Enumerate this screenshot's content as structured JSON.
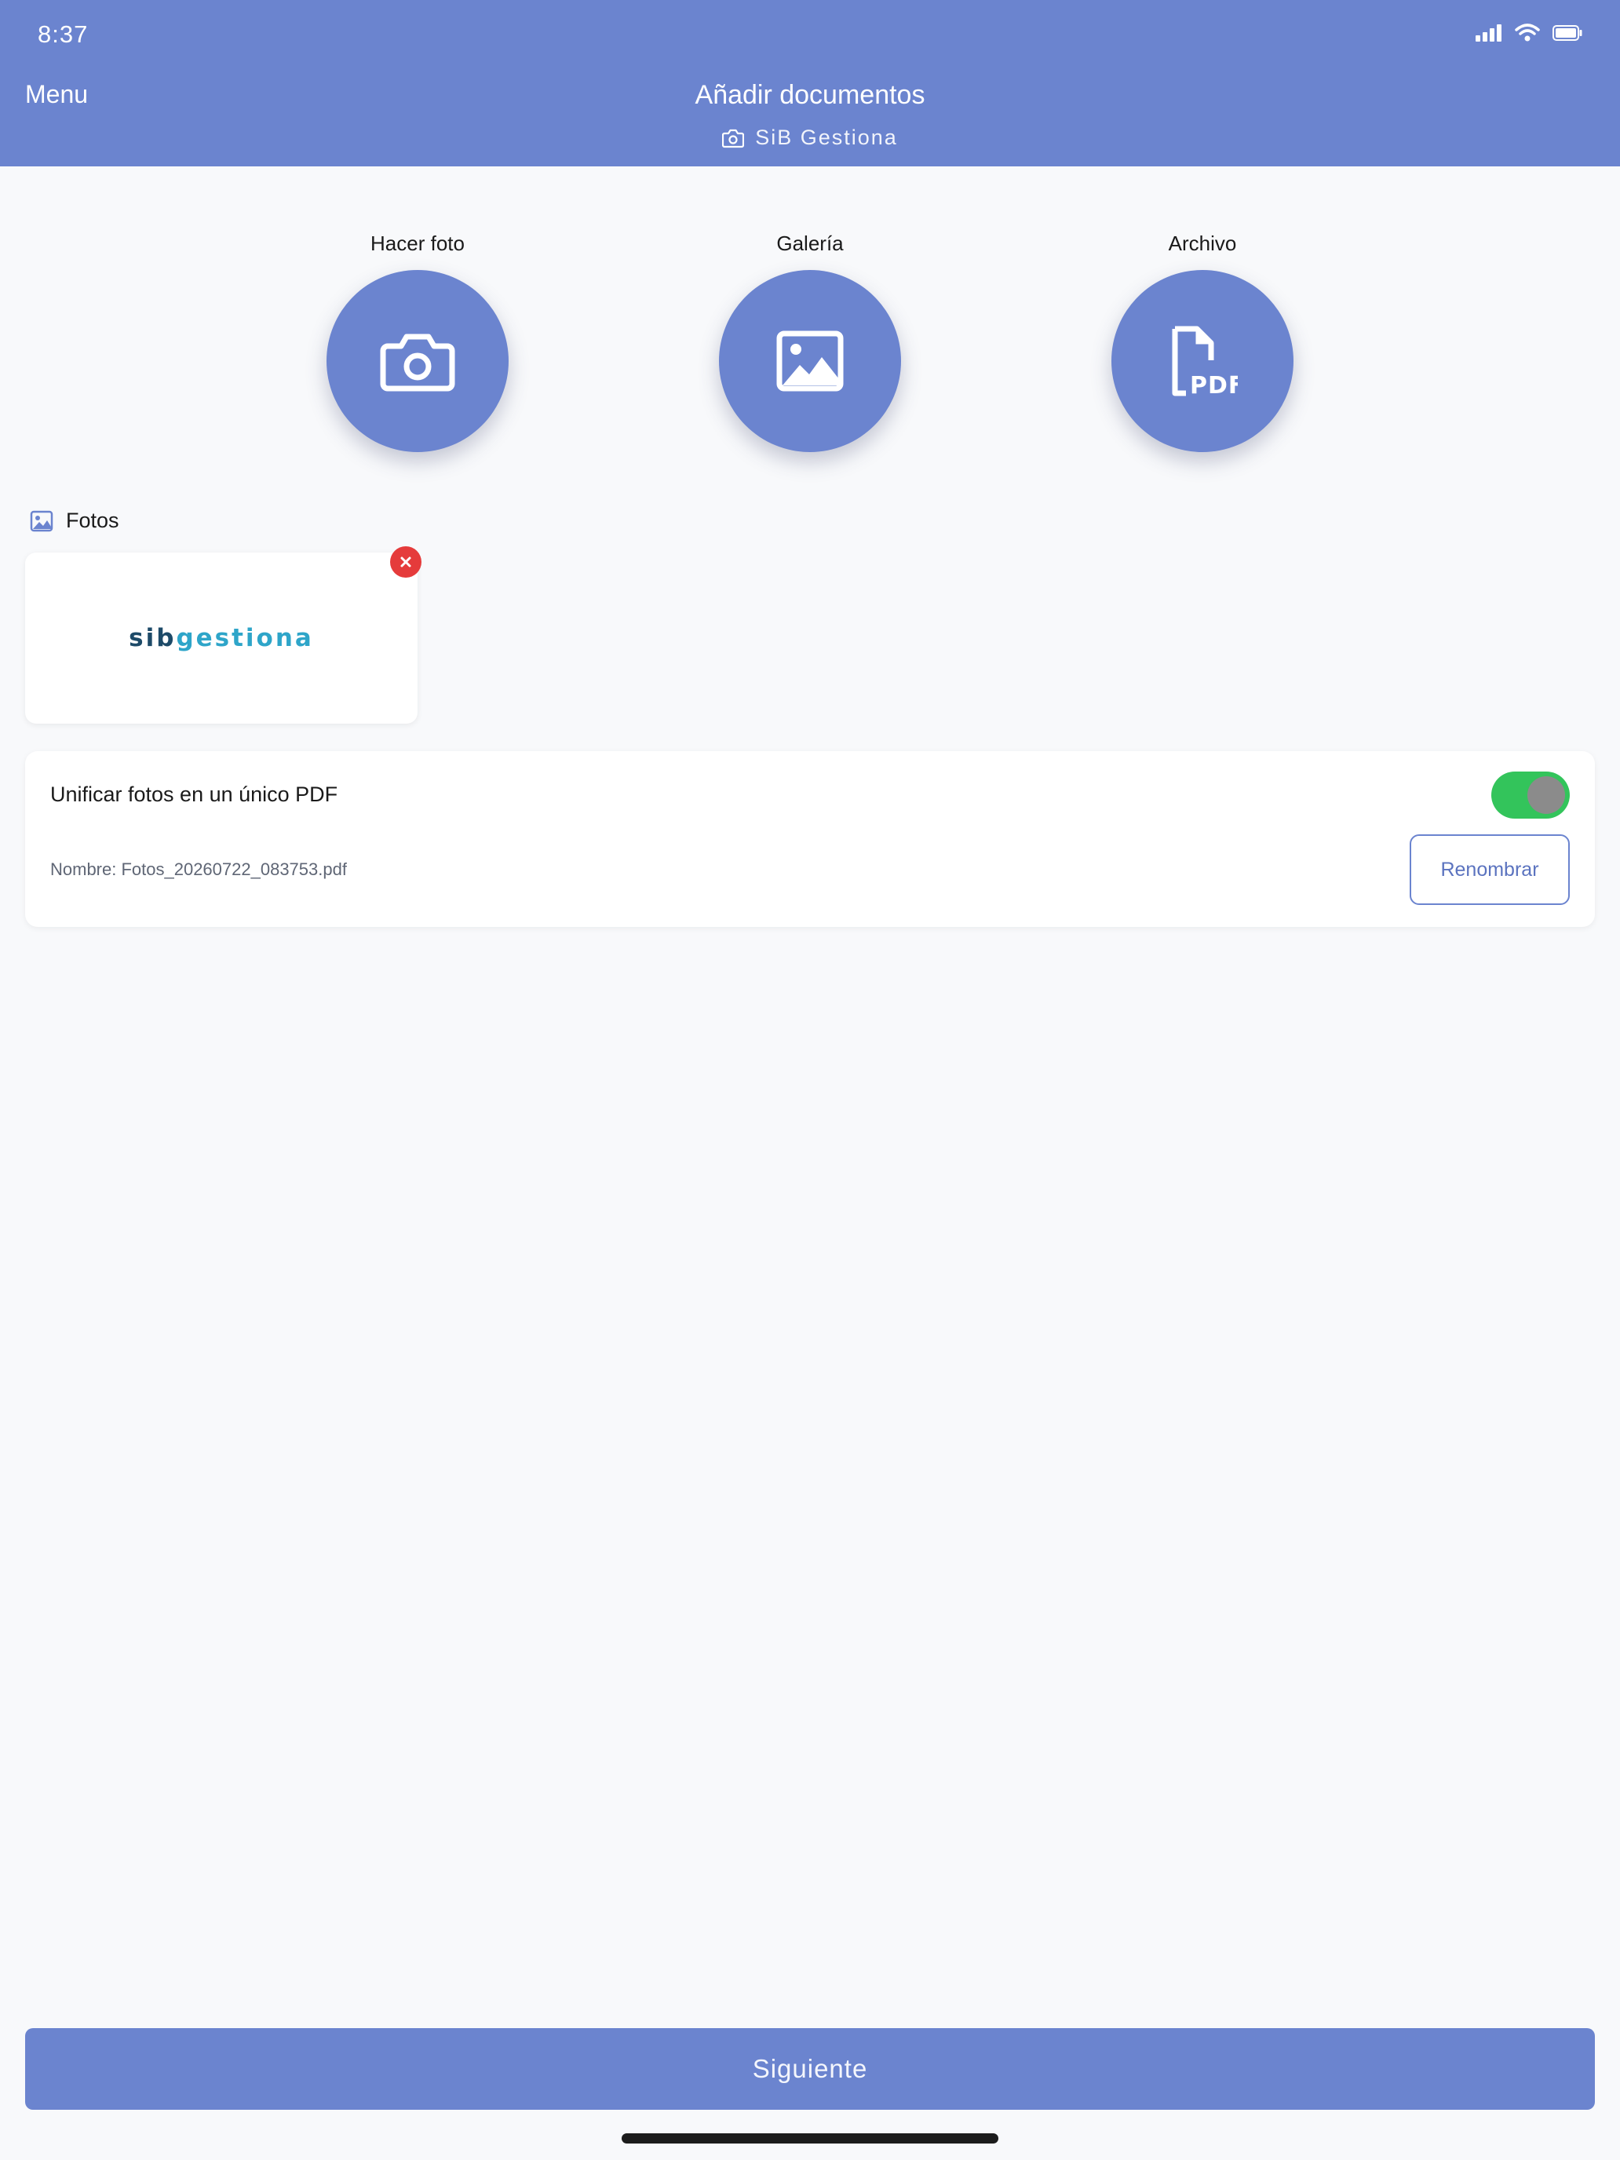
{
  "status_bar": {
    "time": "8:37"
  },
  "header": {
    "menu_label": "Menu",
    "title": "Añadir documentos",
    "subtitle": "SiB Gestiona"
  },
  "actions": [
    {
      "label": "Hacer foto",
      "icon": "camera-icon"
    },
    {
      "label": "Galería",
      "icon": "image-icon"
    },
    {
      "label": "Archivo",
      "icon": "pdf-file-icon"
    }
  ],
  "photos": {
    "section_title": "Fotos",
    "items": [
      {
        "logo_text_a": "sib",
        "logo_text_b": "gestiona"
      }
    ]
  },
  "unify": {
    "label": "Unificar fotos en un único PDF",
    "enabled": true,
    "file_name": "Nombre: Fotos_20260722_083753.pdf",
    "rename_label": "Renombrar"
  },
  "footer": {
    "next_label": "Siguiente"
  },
  "colors": {
    "accent": "#6b84cf",
    "toggle_on": "#33c45b",
    "remove": "#e53b3b",
    "logo_dark": "#1d4a68",
    "logo_light": "#2ea5c9"
  }
}
